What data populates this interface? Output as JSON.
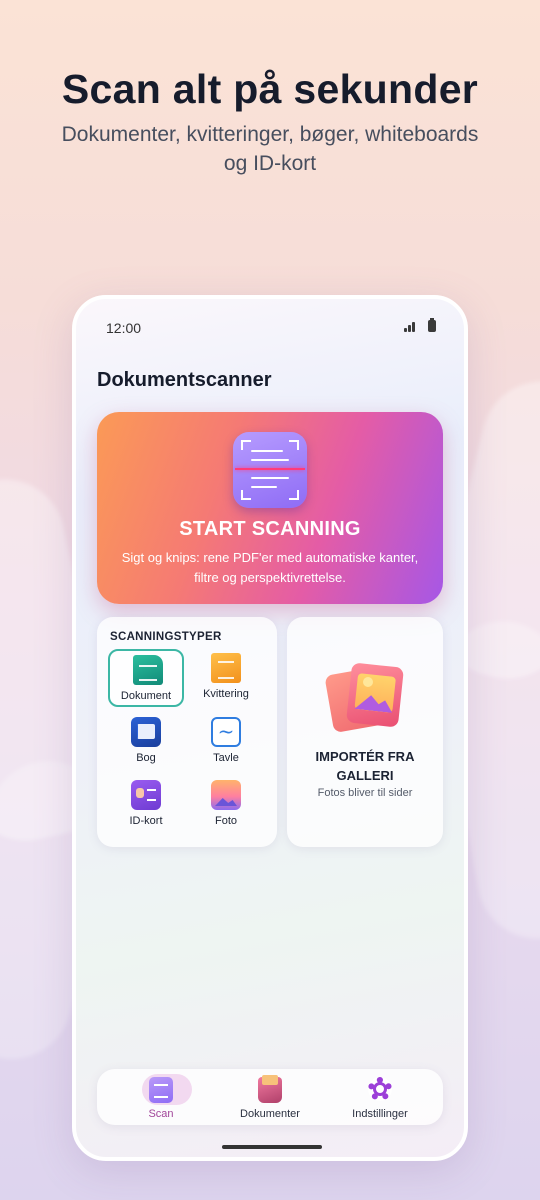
{
  "hero": {
    "title": "Scan alt på sekunder",
    "subtitle_line1": "Dokumenter, kvitteringer, bøger, whiteboards",
    "subtitle_line2": "og ID-kort"
  },
  "status_bar": {
    "time": "12:00",
    "icons": [
      "signal-icon",
      "battery-icon"
    ]
  },
  "app": {
    "title": "Dokumentscanner"
  },
  "scan_card": {
    "title": "START SCANNING",
    "description_line1": "Sigt og knips: rene PDF'er med automatiske kanter,",
    "description_line2": "filtre og perspektivrettelse.",
    "icon": "scan-document-icon"
  },
  "scan_types": {
    "heading": "SCANNINGSTYPER",
    "items": [
      {
        "label": "Dokument",
        "icon": "document-icon",
        "selected": true
      },
      {
        "label": "Kvittering",
        "icon": "receipt-icon",
        "selected": false
      },
      {
        "label": "Bog",
        "icon": "book-icon",
        "selected": false
      },
      {
        "label": "Tavle",
        "icon": "whiteboard-icon",
        "selected": false
      },
      {
        "label": "ID-kort",
        "icon": "id-card-icon",
        "selected": false
      },
      {
        "label": "Foto",
        "icon": "photo-icon",
        "selected": false
      }
    ]
  },
  "import_card": {
    "title_line1": "IMPORTÉR FRA",
    "title_line2": "GALLERI",
    "subtitle": "Fotos bliver til sider",
    "icon": "gallery-icon"
  },
  "bottom_nav": {
    "items": [
      {
        "label": "Scan",
        "icon": "scan-icon",
        "active": true
      },
      {
        "label": "Dokumenter",
        "icon": "folder-icon",
        "active": false
      },
      {
        "label": "Indstillinger",
        "icon": "gear-icon",
        "active": false
      }
    ]
  },
  "colors": {
    "accent_selected": "#3cb7a5",
    "active_nav": "#a2469a",
    "scan_gradient_start": "#fb9a56",
    "scan_gradient_end": "#a657e6"
  }
}
